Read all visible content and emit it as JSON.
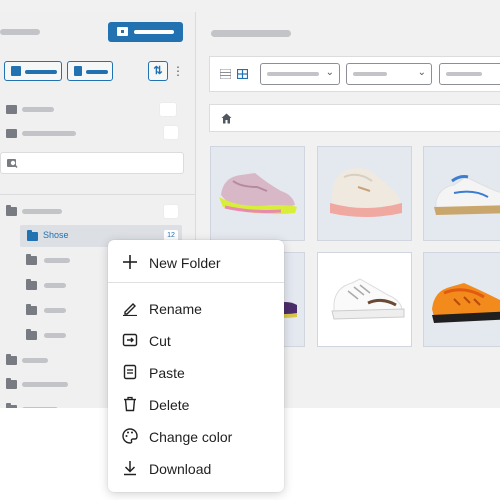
{
  "sidebar": {
    "selected_folder": {
      "name": "Shose",
      "count": "12"
    }
  },
  "context_menu": {
    "items": [
      {
        "label": "New Folder",
        "icon": "plus-icon"
      },
      {
        "label": "Rename",
        "icon": "pencil-icon"
      },
      {
        "label": "Cut",
        "icon": "cut-icon"
      },
      {
        "label": "Paste",
        "icon": "paste-icon"
      },
      {
        "label": "Delete",
        "icon": "trash-icon"
      },
      {
        "label": "Change color",
        "icon": "palette-icon"
      },
      {
        "label": "Download",
        "icon": "download-icon"
      }
    ]
  },
  "colors": {
    "accent": "#2271b1",
    "sidebar_bg": "#f0f0f1",
    "selected_row_bg": "#dcdfe4",
    "thumb_bg": "#e4e8ef"
  },
  "gallery": {
    "items": [
      {
        "icon": "sneaker-lime-pink"
      },
      {
        "icon": "sneaker-cream-pink"
      },
      {
        "icon": "sneaker-white-blue"
      },
      {
        "icon": "sneaker-purple-partial"
      },
      {
        "icon": "sneaker-white-brown"
      },
      {
        "icon": "sneaker-orange-black"
      }
    ]
  }
}
